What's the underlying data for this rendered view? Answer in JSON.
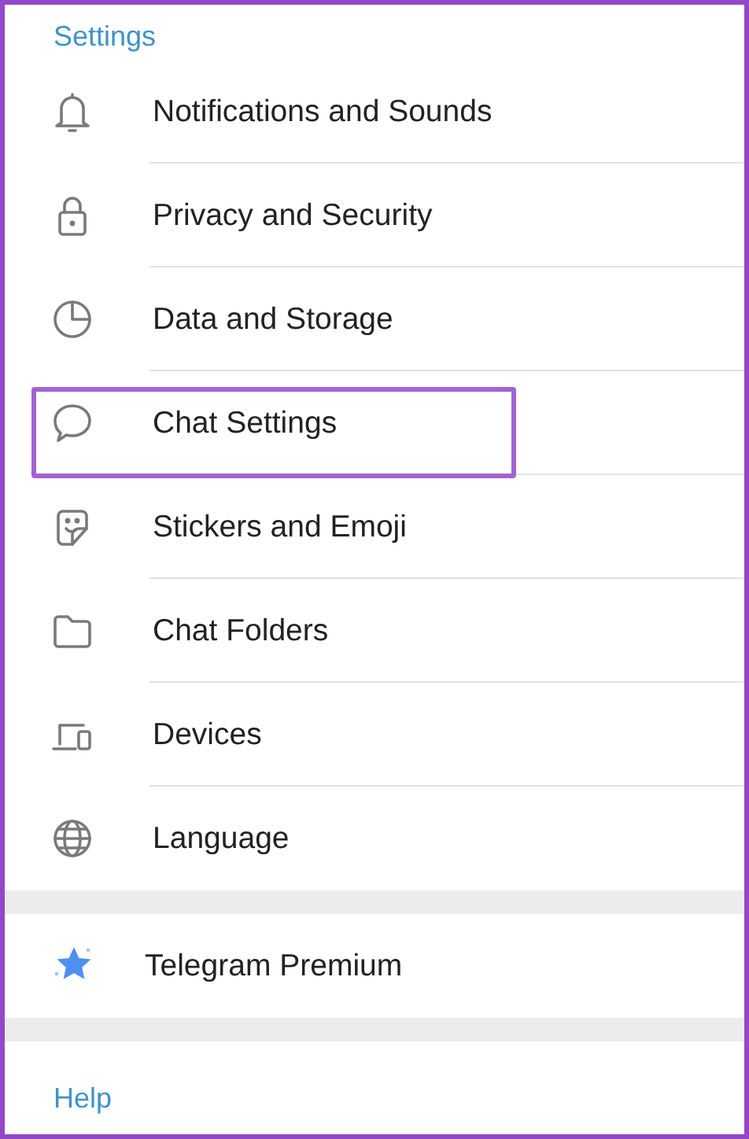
{
  "sections": [
    {
      "title": "Settings",
      "items": [
        {
          "label": "Notifications and Sounds",
          "highlighted": false
        },
        {
          "label": "Privacy and Security",
          "highlighted": false
        },
        {
          "label": "Data and Storage",
          "highlighted": false
        },
        {
          "label": "Chat Settings",
          "highlighted": true
        },
        {
          "label": "Stickers and Emoji",
          "highlighted": false
        },
        {
          "label": "Chat Folders",
          "highlighted": false
        },
        {
          "label": "Devices",
          "highlighted": false
        },
        {
          "label": "Language",
          "highlighted": false
        }
      ]
    },
    {
      "items": [
        {
          "label": "Telegram Premium",
          "highlighted": false
        }
      ]
    },
    {
      "title": "Help"
    }
  ]
}
